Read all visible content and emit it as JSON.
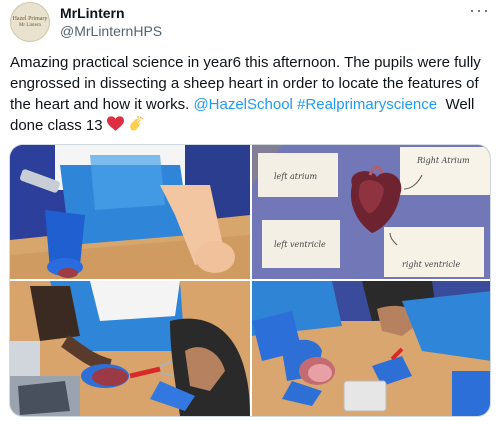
{
  "author": {
    "display_name": "MrLintern",
    "handle": "@MrLinternHPS",
    "avatar_text_line1": "Hazel Primary",
    "avatar_text_line2": "Mr Lintern"
  },
  "menu": {
    "more_label": "···"
  },
  "tweet": {
    "text_main": "Amazing practical science in year6 this afternoon. The pupils were fully engrossed in dissecting a sheep heart in order to locate the features of the heart and how it works.",
    "mention": "@HazelSchool",
    "hashtag": "#Realprimaryscience",
    "text_end": "Well done class 13",
    "emojis": [
      "red-heart",
      "clapping-hands"
    ]
  },
  "media": {
    "photos": [
      {
        "name": "pupil-with-gloves-photo"
      },
      {
        "name": "labelled-heart-photo",
        "labels": [
          "left atrium",
          "Right Atrium",
          "left ventricle",
          "right ventricle"
        ]
      },
      {
        "name": "pupil-dissecting-photo"
      },
      {
        "name": "pupils-table-photo"
      }
    ]
  },
  "colors": {
    "link": "#1d9bf0",
    "secondary_text": "#536471",
    "border": "#cfd9de"
  }
}
